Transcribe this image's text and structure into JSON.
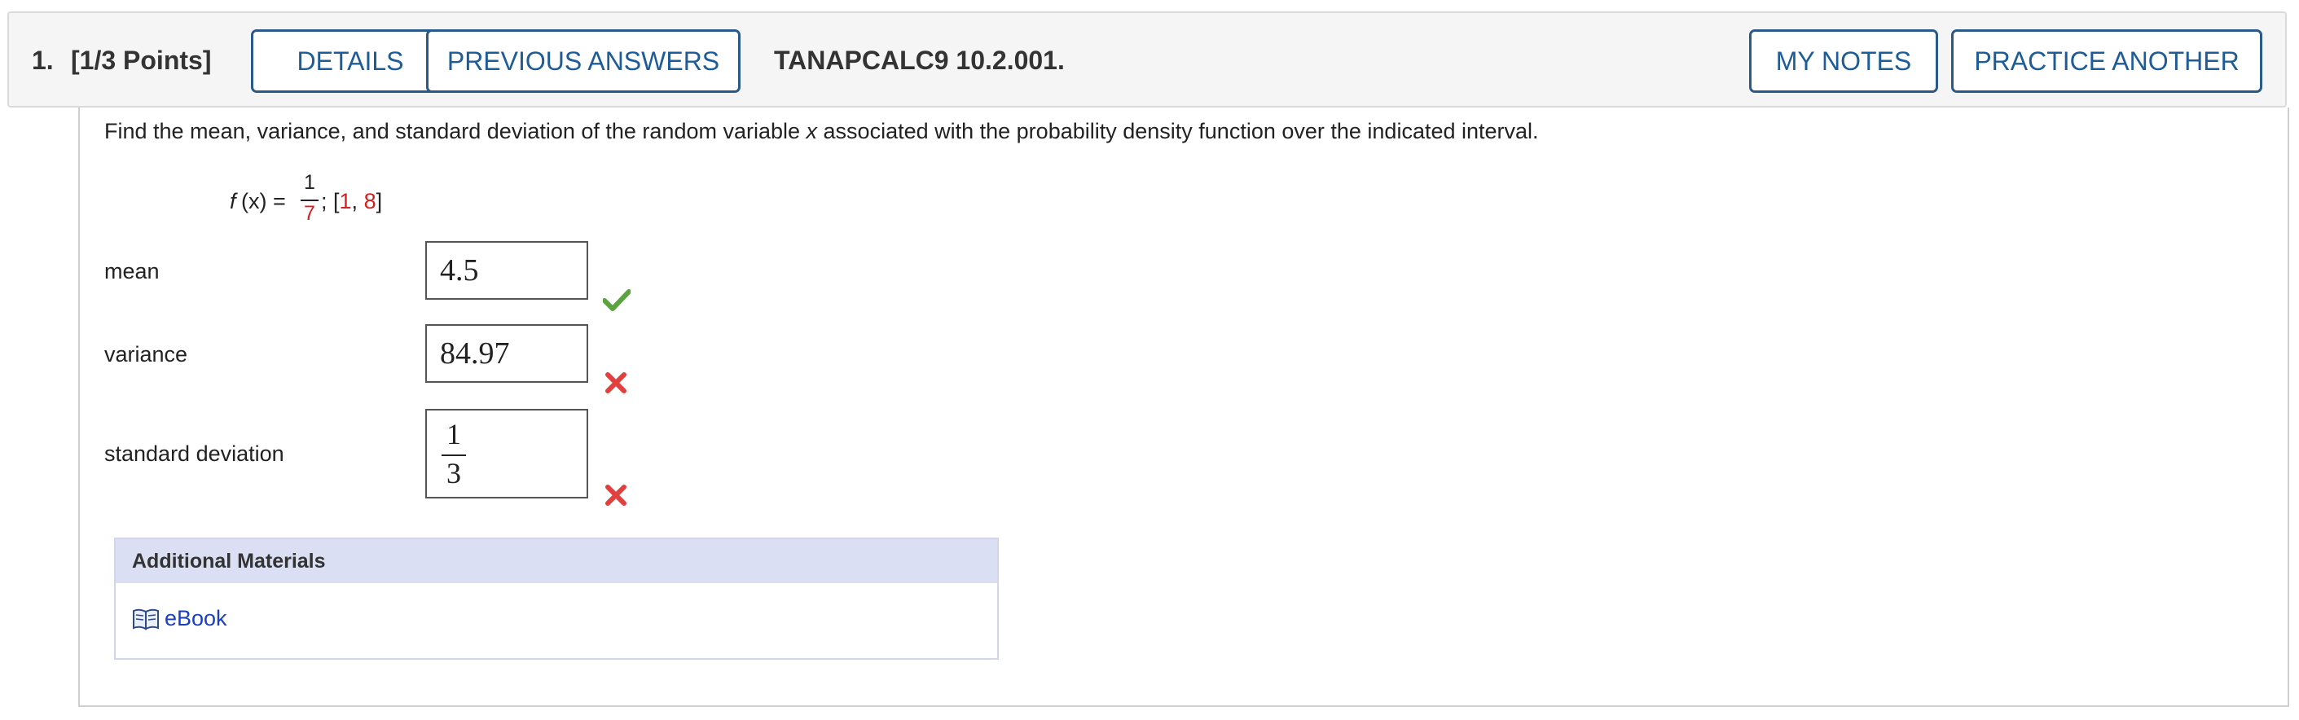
{
  "header": {
    "question_number": "1.",
    "points": "[1/3 Points]",
    "details_label": "DETAILS",
    "previous_answers_label": "PREVIOUS ANSWERS",
    "problem_id": "TANAPCALC9 10.2.001.",
    "my_notes_label": "MY NOTES",
    "practice_another_label": "PRACTICE ANOTHER"
  },
  "question": {
    "prompt_before": "Find the mean, variance, and standard deviation of the random variable ",
    "prompt_var": "x",
    "prompt_after": " associated with the probability density function over the indicated interval.",
    "fn_name": "f",
    "fn_arg": "(x) =",
    "fn_numerator": "1",
    "fn_denominator": "7",
    "interval_open": "; [",
    "interval_a": "1",
    "interval_sep": ", ",
    "interval_b": "8",
    "interval_close": "]"
  },
  "answers": [
    {
      "label": "mean",
      "value": "4.5",
      "status": "correct",
      "icon": "checkmark-icon"
    },
    {
      "label": "variance",
      "value": "84.97",
      "status": "incorrect",
      "icon": "x-icon"
    },
    {
      "label": "standard deviation",
      "numerator": "1",
      "denominator": "3",
      "status": "incorrect",
      "icon": "x-icon"
    }
  ],
  "additional_materials": {
    "title": "Additional Materials",
    "ebook_label": "eBook",
    "icon": "book-icon"
  },
  "colors": {
    "button_border": "#2a5a88",
    "button_text": "#1e5c97",
    "correct": "#5aa33f",
    "incorrect": "#e0403e",
    "highlight_red": "#d6201f",
    "materials_header_bg": "#dadff3",
    "link": "#1a3ec4"
  }
}
